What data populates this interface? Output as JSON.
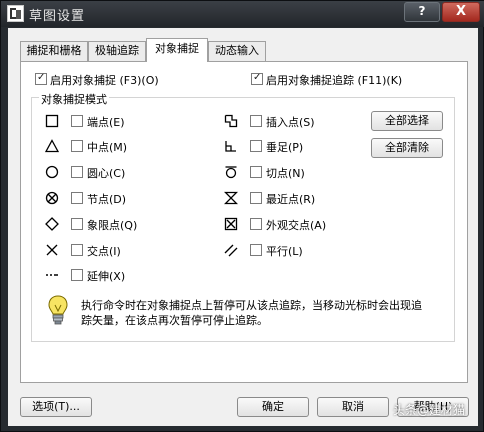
{
  "window": {
    "title": "草图设置",
    "help_glyph": "?",
    "close_glyph": "X"
  },
  "tabs": [
    {
      "label": "捕捉和栅格",
      "active": false
    },
    {
      "label": "极轴追踪",
      "active": false
    },
    {
      "label": "对象捕捉",
      "active": true
    },
    {
      "label": "动态输入",
      "active": false
    }
  ],
  "top_options": {
    "enable_snap": {
      "label": "启用对象捕捉 (F3)(O)",
      "checked": true
    },
    "enable_tracking": {
      "label": "启用对象捕捉追踪 (F11)(K)",
      "checked": true
    }
  },
  "group_title": "对象捕捉模式",
  "modes_left": [
    {
      "icon": "square-icon",
      "label": "端点(E)",
      "checked": false
    },
    {
      "icon": "triangle-icon",
      "label": "中点(M)",
      "checked": false
    },
    {
      "icon": "circle-icon",
      "label": "圆心(C)",
      "checked": false
    },
    {
      "icon": "node-icon",
      "label": "节点(D)",
      "checked": false
    },
    {
      "icon": "diamond-icon",
      "label": "象限点(Q)",
      "checked": false
    },
    {
      "icon": "cross-icon",
      "label": "交点(I)",
      "checked": false
    },
    {
      "icon": "extension-icon",
      "label": "延伸(X)",
      "checked": false
    }
  ],
  "modes_right": [
    {
      "icon": "insertion-icon",
      "label": "插入点(S)",
      "checked": false
    },
    {
      "icon": "perpendicular-icon",
      "label": "垂足(P)",
      "checked": false
    },
    {
      "icon": "tangent-icon",
      "label": "切点(N)",
      "checked": false
    },
    {
      "icon": "nearest-icon",
      "label": "最近点(R)",
      "checked": false
    },
    {
      "icon": "apparent-intersection-icon",
      "label": "外观交点(A)",
      "checked": false
    },
    {
      "icon": "parallel-icon",
      "label": "平行(L)",
      "checked": false
    }
  ],
  "buttons": {
    "select_all": "全部选择",
    "clear_all": "全部清除",
    "options": "选项(T)...",
    "ok": "确定",
    "cancel": "取消",
    "help": "帮助(H)"
  },
  "tip_text": "执行命令时在对象捕捉点上暂停可从该点追踪，当移动光标时会出现追踪矢量，在该点再次暂停可停止追踪。",
  "watermark": "头条@建材猫"
}
